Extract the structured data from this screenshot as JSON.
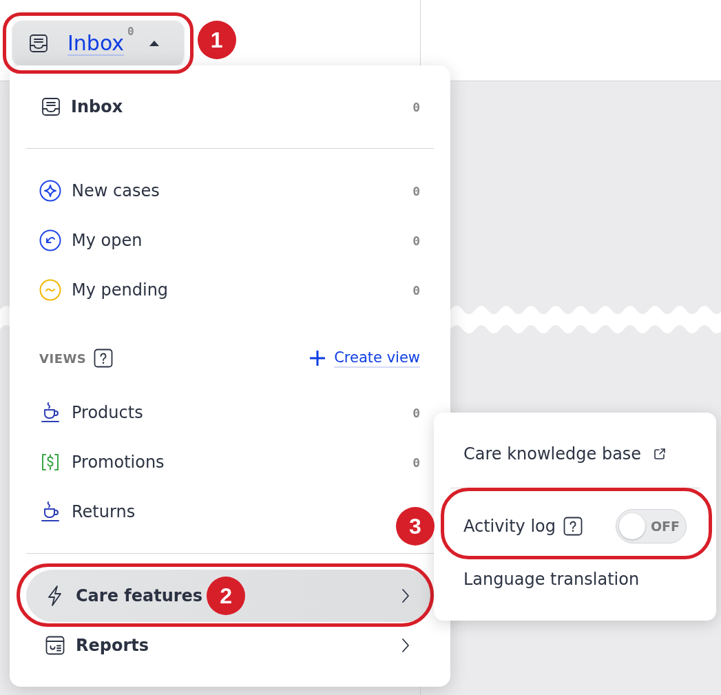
{
  "header": {
    "inbox_button": {
      "label": "Inbox",
      "count": "0",
      "expanded": true,
      "callout": "1"
    }
  },
  "menu": {
    "inbox": {
      "label": "Inbox",
      "count": "0"
    },
    "queues": [
      {
        "kind": "sparkle",
        "label": "New cases",
        "count": "0",
        "color": "#1f45e6"
      },
      {
        "kind": "return",
        "label": "My open",
        "count": "0",
        "color": "#1f45e6"
      },
      {
        "kind": "pending",
        "label": "My pending",
        "count": "0",
        "color": "#f2b705"
      }
    ],
    "views": {
      "title": "VIEWS",
      "help": true,
      "action": "Create view",
      "items": [
        {
          "kind": "cup",
          "label": "Products",
          "count": "0",
          "color": "#2d3fb6"
        },
        {
          "kind": "dollar",
          "label": "Promotions",
          "count": "0",
          "color": "#3aa548"
        },
        {
          "kind": "cup",
          "label": "Returns",
          "color": "#2d3fb6"
        }
      ]
    },
    "footer_items": [
      {
        "kind": "bolt",
        "label": "Care features",
        "selected": true,
        "callout": "2"
      },
      {
        "kind": "report",
        "label": "Reports",
        "selected": false
      }
    ]
  },
  "submenu": {
    "items": [
      {
        "kind": "external_link",
        "label": "Care knowledge base"
      },
      {
        "kind": "toggle",
        "label": "Activity log",
        "help": true,
        "on": false,
        "state_text": "OFF",
        "callout": "3"
      },
      {
        "kind": "plain",
        "label": "Language translation"
      }
    ]
  }
}
